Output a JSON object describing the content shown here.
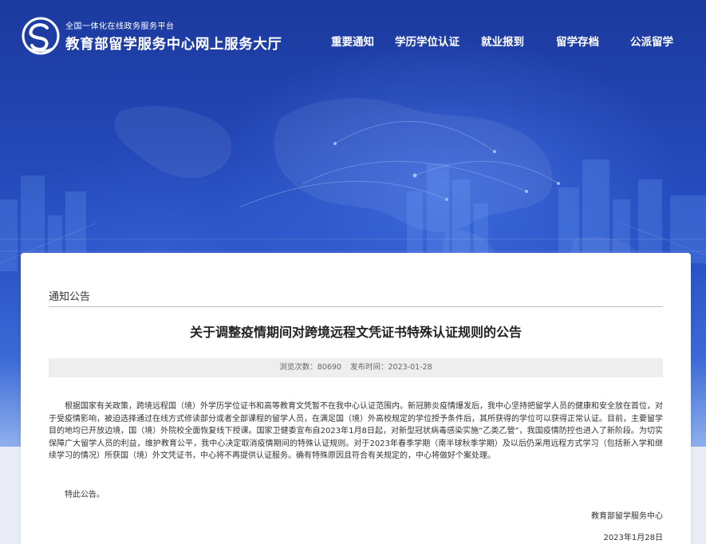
{
  "header": {
    "platform_tagline": "全国一体化在线政务服务平台",
    "site_title": "教育部留学服务中心网上服务大厅",
    "logo_icon": "cscse-logo-icon"
  },
  "nav": {
    "items": [
      {
        "label": "重要通知"
      },
      {
        "label": "学历学位认证"
      },
      {
        "label": "就业报到"
      },
      {
        "label": "留学存档"
      },
      {
        "label": "公派留学"
      }
    ]
  },
  "article": {
    "section": "通知公告",
    "title": "关于调整疫情期间对跨境远程文凭证书特殊认证规则的公告",
    "views_label": "浏览次数：80690",
    "published_label": "发布时间：2023-01-28",
    "body": "根据国家有关政策，跨境远程国（境）外学历学位证书和高等教育文凭暂不在我中心认证范围内。新冠肺炎疫情爆发后，我中心坚持把留学人员的健康和安全放在首位，对于受疫情影响，被迫选择通过在线方式修读部分或者全部课程的留学人员，在满足国（境）外高校规定的学位授予条件后，其所获得的学位可以获得正常认证。目前，主要留学目的地均已开放边境，国（境）外院校全面恢复线下授课。国家卫健委宣布自2023年1月8日起，对新型冠状病毒感染实施“乙类乙管”，我国疫情防控也进入了新阶段。为切实保障广大留学人员的利益，维护教育公平，我中心决定取消疫情期间的特殊认证规则。对于2023年春季学期（南半球秋季学期）及以后仍采用远程方式学习（包括新入学和继续学习的情况）所获国（境）外文凭证书，中心将不再提供认证服务。确有特殊原因且符合有关规定的，中心将做好个案处理。",
    "closing": "特此公告。",
    "signature_org": "教育部留学服务中心",
    "signature_date": "2023年1月28日"
  },
  "colors": {
    "banner_dark": "#1c3a9e",
    "banner_light": "#3b6ad6",
    "text_primary": "#333333",
    "meta_bg": "#eeeeee"
  }
}
